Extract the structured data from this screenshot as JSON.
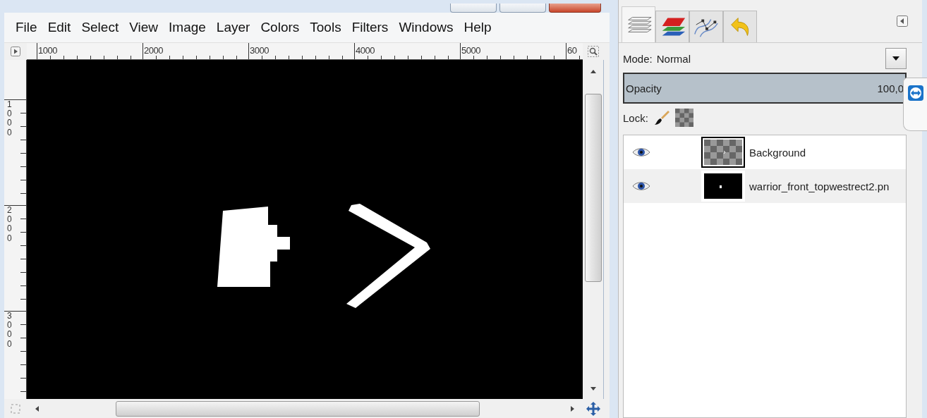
{
  "menu": [
    {
      "label": "File"
    },
    {
      "label": "Edit"
    },
    {
      "label": "Select"
    },
    {
      "label": "View"
    },
    {
      "label": "Image"
    },
    {
      "label": "Layer"
    },
    {
      "label": "Colors"
    },
    {
      "label": "Tools"
    },
    {
      "label": "Filters"
    },
    {
      "label": "Windows"
    },
    {
      "label": "Help"
    }
  ],
  "h_ruler": [
    "1000",
    "2000",
    "3000",
    "4000",
    "5000",
    "60"
  ],
  "v_ruler": [
    "1000",
    "2000",
    "3000"
  ],
  "dock": {
    "tabs": [
      {
        "kind": "layers",
        "selected": true
      },
      {
        "kind": "channels",
        "selected": false
      },
      {
        "kind": "paths",
        "selected": false
      },
      {
        "kind": "undo",
        "selected": false
      }
    ],
    "mode": {
      "label": "Mode:",
      "value": "Normal"
    },
    "opacity": {
      "label": "Opacity",
      "value": "100,0",
      "level": 1
    },
    "lock": {
      "label": "Lock:"
    },
    "layers": [
      {
        "name": "Background",
        "visible": true,
        "selected": true,
        "kind": "checker"
      },
      {
        "name": "warrior_front_topwestrect2.pn",
        "visible": true,
        "selected": false,
        "kind": "black"
      }
    ]
  }
}
